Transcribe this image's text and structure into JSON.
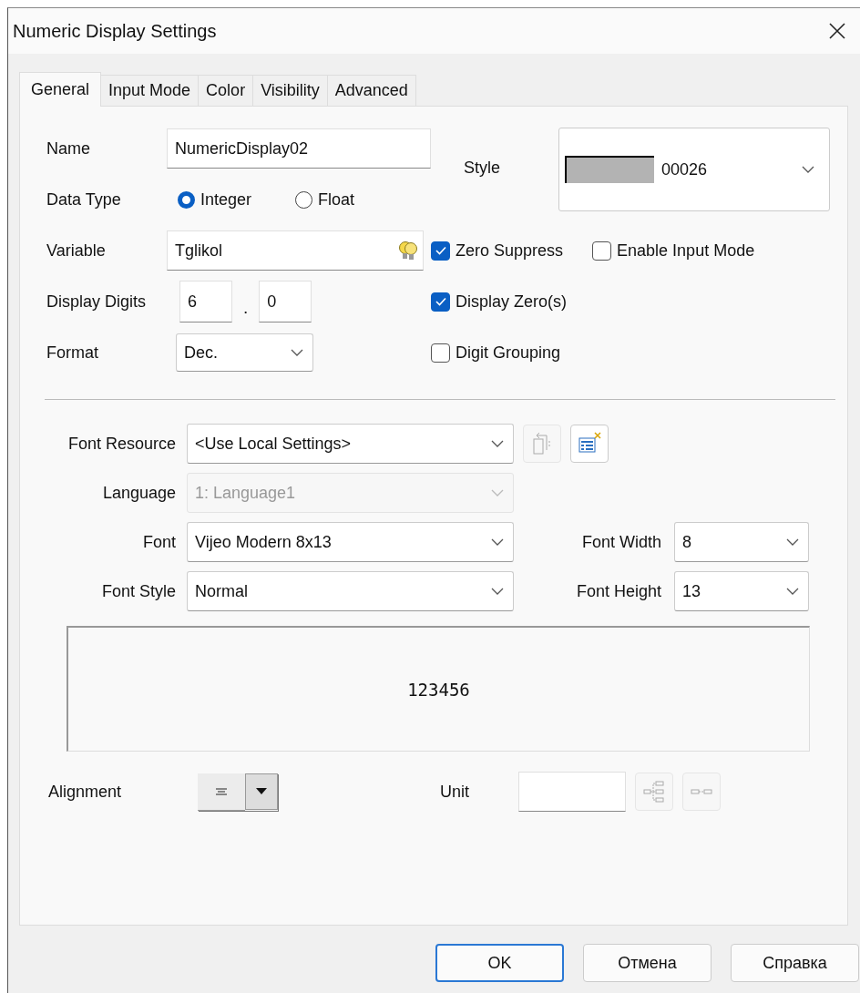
{
  "window": {
    "title": "Numeric Display Settings"
  },
  "tabs": [
    {
      "label": "General",
      "selected": true
    },
    {
      "label": "Input Mode",
      "selected": false
    },
    {
      "label": "Color",
      "selected": false
    },
    {
      "label": "Visibility",
      "selected": false
    },
    {
      "label": "Advanced",
      "selected": false
    }
  ],
  "general": {
    "name": {
      "label": "Name",
      "value": "NumericDisplay02"
    },
    "style": {
      "label": "Style",
      "value": "00026"
    },
    "data_type": {
      "label": "Data Type",
      "options": [
        {
          "label": "Integer",
          "selected": true
        },
        {
          "label": "Float",
          "selected": false
        }
      ]
    },
    "variable": {
      "label": "Variable",
      "value": "Tglikol"
    },
    "display_digits": {
      "label": "Display Digits",
      "integer": "6",
      "separator": ".",
      "decimal": "0"
    },
    "format": {
      "label": "Format",
      "value": "Dec."
    },
    "checkboxes": [
      {
        "label": "Zero Suppress",
        "checked": true
      },
      {
        "label": "Enable Input Mode",
        "checked": false
      },
      {
        "label": "Display Zero(s)",
        "checked": true
      },
      {
        "label": "Digit Grouping",
        "checked": false
      }
    ]
  },
  "font": {
    "rows": [
      {
        "label": "Font Resource",
        "value": "<Use Local Settings>",
        "disabled": false
      },
      {
        "label": "Language",
        "value": "1: Language1",
        "disabled": true
      },
      {
        "label": "Font",
        "value": "Vijeo Modern 8x13",
        "disabled": false
      },
      {
        "label": "Font Style",
        "value": "Normal",
        "disabled": false
      }
    ],
    "font_width": {
      "label": "Font Width",
      "value": "8"
    },
    "font_height": {
      "label": "Font Height",
      "value": "13"
    }
  },
  "preview": {
    "text": "123456"
  },
  "alignment": {
    "label": "Alignment"
  },
  "unit": {
    "label": "Unit"
  },
  "buttons": [
    {
      "label": "OK",
      "default": true
    },
    {
      "label": "Отмена",
      "default": false
    },
    {
      "label": "Справка",
      "default": false
    }
  ]
}
